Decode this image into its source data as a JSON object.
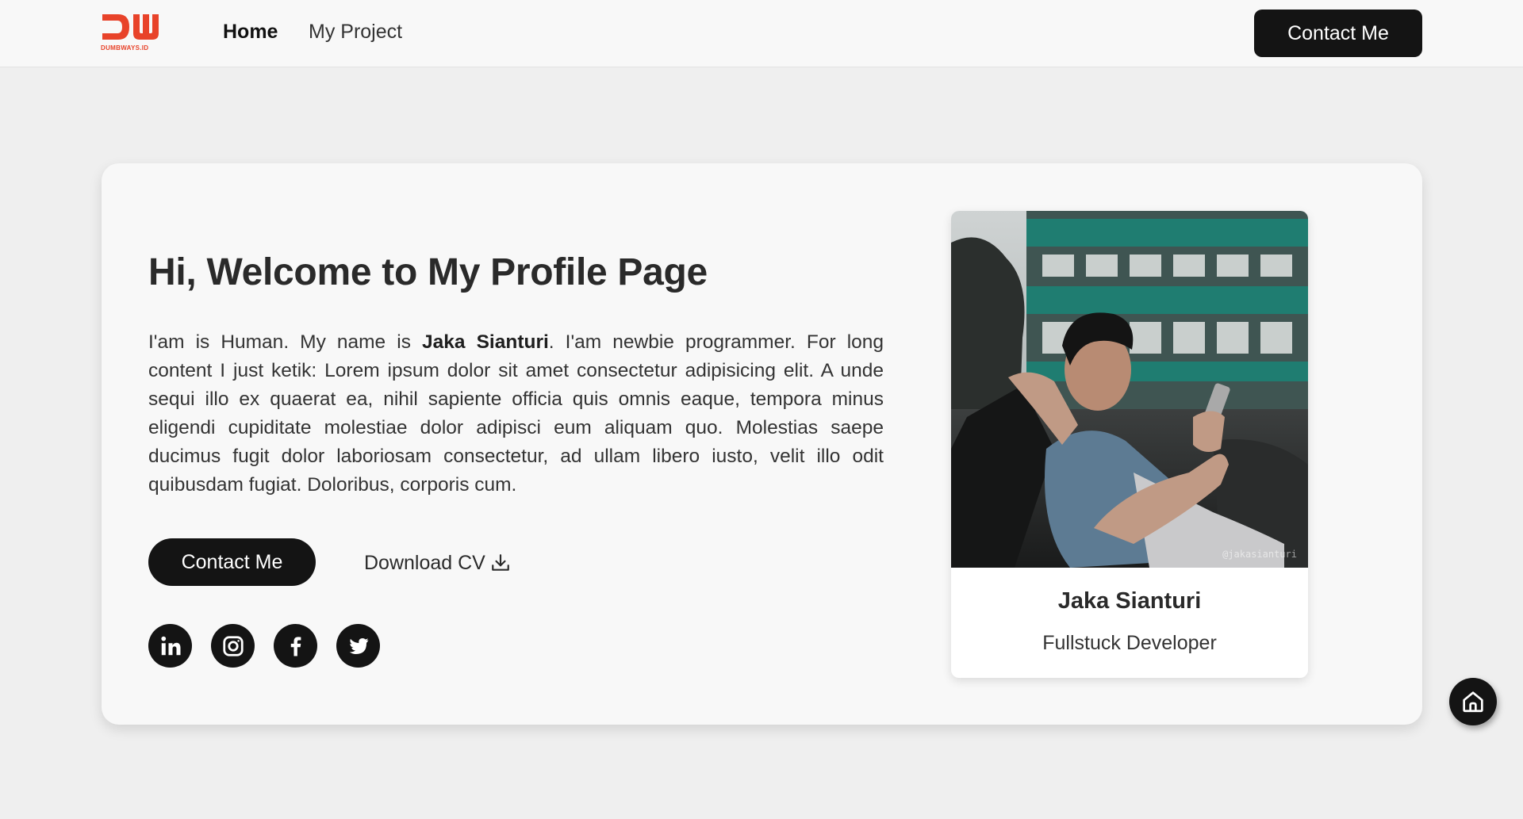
{
  "nav": {
    "logo_text": "DW",
    "logo_caption": "DUMBWAYS.ID",
    "home_label": "Home",
    "project_label": "My Project",
    "contact_label": "Contact Me"
  },
  "hero": {
    "title": "Hi, Welcome to My Profile Page",
    "intro_before": "I'am is Human. My name is ",
    "intro_name": "Jaka Sianturi",
    "intro_after": ". I'am newbie programmer. For long content I just ketik: Lorem ipsum dolor sit amet consectetur adipisicing elit. A unde sequi illo ex quaerat ea, nihil sapiente officia quis omnis eaque, tempora minus eligendi cupiditate molestiae dolor adipisci eum aliquam quo. Molestias saepe ducimus fugit dolor laboriosam consectetur, ad ullam libero iusto, velit illo odit quibusdam fugiat. Doloribus, corporis cum.",
    "contact_label": "Contact Me",
    "download_label": "Download CV",
    "download_icon": "download-icon"
  },
  "socials": [
    {
      "name": "linkedin",
      "icon": "linkedin-icon"
    },
    {
      "name": "instagram",
      "icon": "instagram-icon"
    },
    {
      "name": "facebook",
      "icon": "facebook-icon"
    },
    {
      "name": "twitter",
      "icon": "twitter-icon"
    }
  ],
  "profile": {
    "name": "Jaka Sianturi",
    "role": "Fullstuck Developer",
    "photo_watermark": "@jakasianturi"
  },
  "fab": {
    "icon": "home-icon"
  },
  "colors": {
    "brand_red": "#e8432a",
    "dark": "#141414",
    "page_bg": "#efefef",
    "card_bg": "#f8f8f8"
  }
}
